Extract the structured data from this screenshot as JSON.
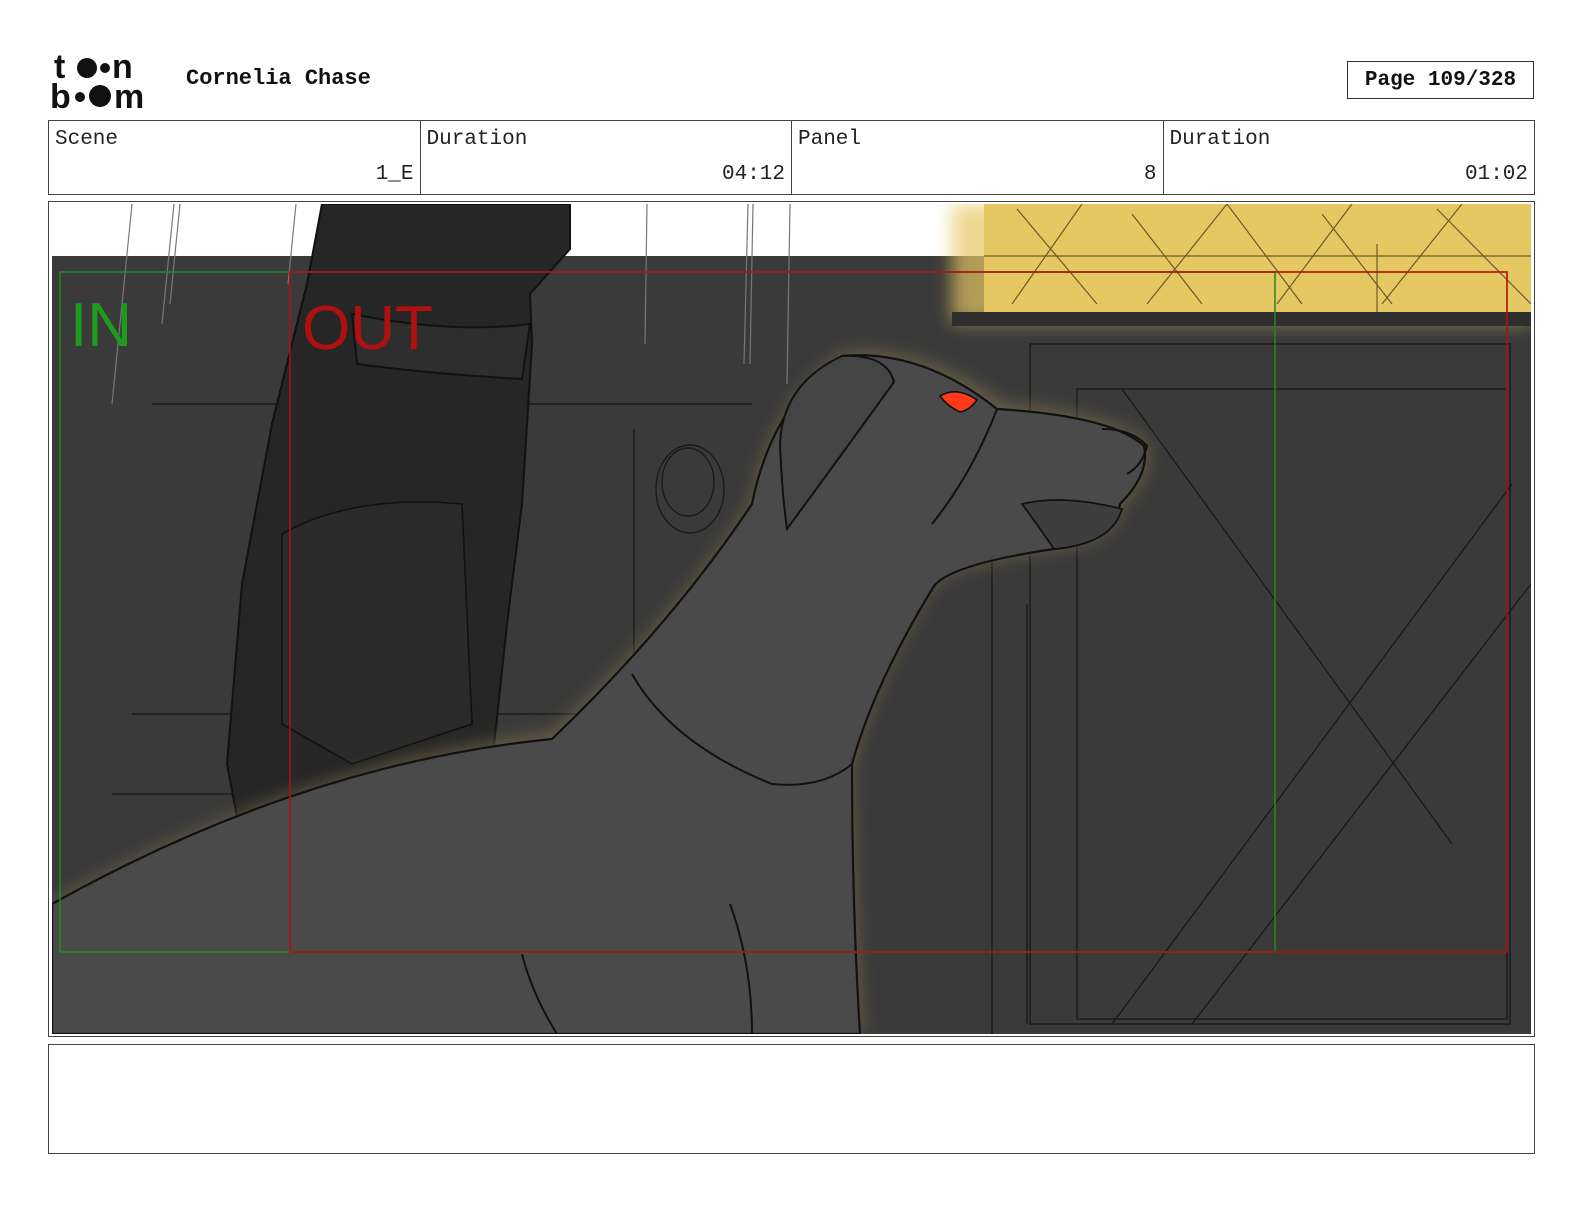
{
  "header": {
    "logo_text": "toon boom",
    "project_title": "Cornelia Chase",
    "page_label": "Page 109/328"
  },
  "info": {
    "scene_label": "Scene",
    "scene_value": "1_E",
    "scene_duration_label": "Duration",
    "scene_duration_value": "04:12",
    "panel_label": "Panel",
    "panel_value": "8",
    "panel_duration_label": "Duration",
    "panel_duration_value": "01:02"
  },
  "panel": {
    "in_marker": "IN",
    "out_marker": "OUT",
    "colors": {
      "in_frame": "#1e8a1e",
      "out_frame": "#b01010",
      "background": "#3a3a3a",
      "window_light": "#e6c862",
      "dog": "#4a4a4a",
      "eye": "#ff3a1a"
    }
  },
  "notes": {
    "text": ""
  }
}
